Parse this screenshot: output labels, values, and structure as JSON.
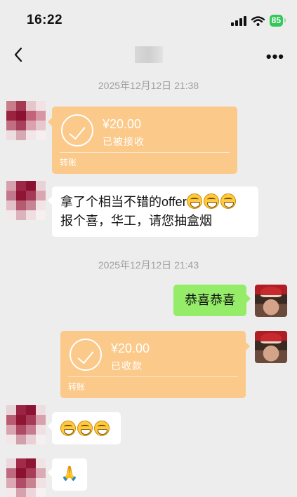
{
  "status_bar": {
    "time": "16:22",
    "battery": "85"
  },
  "nav": {
    "back_icon": "chevron-left-icon",
    "more_label": "•••"
  },
  "messages": {
    "ts1": "2025年12月12日 21:38",
    "transfer1": {
      "amount": "¥20.00",
      "status": "已被接收",
      "type": "转账"
    },
    "text1_line1": "拿了个相当不错的offer",
    "text1_line2": "报个喜，华工，请您抽盒烟",
    "ts2": "2025年12月12日 21:43",
    "reply": "恭喜恭喜",
    "transfer2": {
      "amount": "¥20.00",
      "status": "已收款",
      "type": "转账"
    },
    "emoji_name": "grinning-face-emoji",
    "gesture_emoji": "🙏"
  }
}
